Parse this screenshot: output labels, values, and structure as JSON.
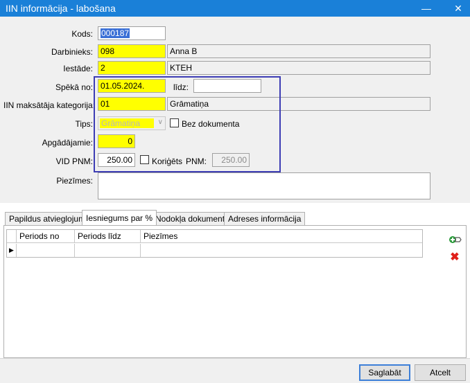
{
  "window": {
    "title": "IIN informācija - labošana",
    "minimize": "—",
    "close": "✕"
  },
  "form": {
    "kods": {
      "label": "Kods:",
      "value": "000187"
    },
    "darbinieks": {
      "label": "Darbinieks:",
      "code": "098",
      "name": "Anna B"
    },
    "iestade": {
      "label": "Iestāde:",
      "code": "2",
      "name": "KTEH"
    },
    "speka_no": {
      "label": "Spēkā no:",
      "value": "01.05.2024."
    },
    "lidz": {
      "label": "līdz:",
      "value": ""
    },
    "kategorija": {
      "label": "IIN maksātāja kategorija:",
      "code": "01",
      "name": "Grāmatiņa"
    },
    "tips": {
      "label": "Tips:",
      "value": "Grāmatiņa"
    },
    "bez_dokumenta": {
      "label": "Bez dokumenta"
    },
    "apgadajamie": {
      "label": "Apgādājamie:",
      "value": "0"
    },
    "vid_pnm": {
      "label": "VID PNM:",
      "value": "250.00"
    },
    "koriguets": {
      "label": "Koriģēts"
    },
    "pnm": {
      "label": "PNM:",
      "value": "250.00"
    },
    "piezimes": {
      "label": "Piezīmes:",
      "value": ""
    }
  },
  "tabs": [
    {
      "label": "Papildus atvieglojumi"
    },
    {
      "label": "Iesniegums par %"
    },
    {
      "label": "Nodokļa dokuments"
    },
    {
      "label": "Adreses informācija"
    }
  ],
  "grid": {
    "columns": [
      "Periods no",
      "Periods līdz",
      "Piezīmes"
    ],
    "row_indicator": "▶"
  },
  "icons": {
    "add": "add-icon",
    "delete": "delete-icon"
  },
  "colors": {
    "accent": "#1a80d8",
    "required": "#ffff00",
    "delete": "#e0201a",
    "add": "#2a9a3a",
    "highlight": "#3c3cb4"
  },
  "buttons": {
    "save": "Saglabāt",
    "cancel": "Atcelt"
  }
}
